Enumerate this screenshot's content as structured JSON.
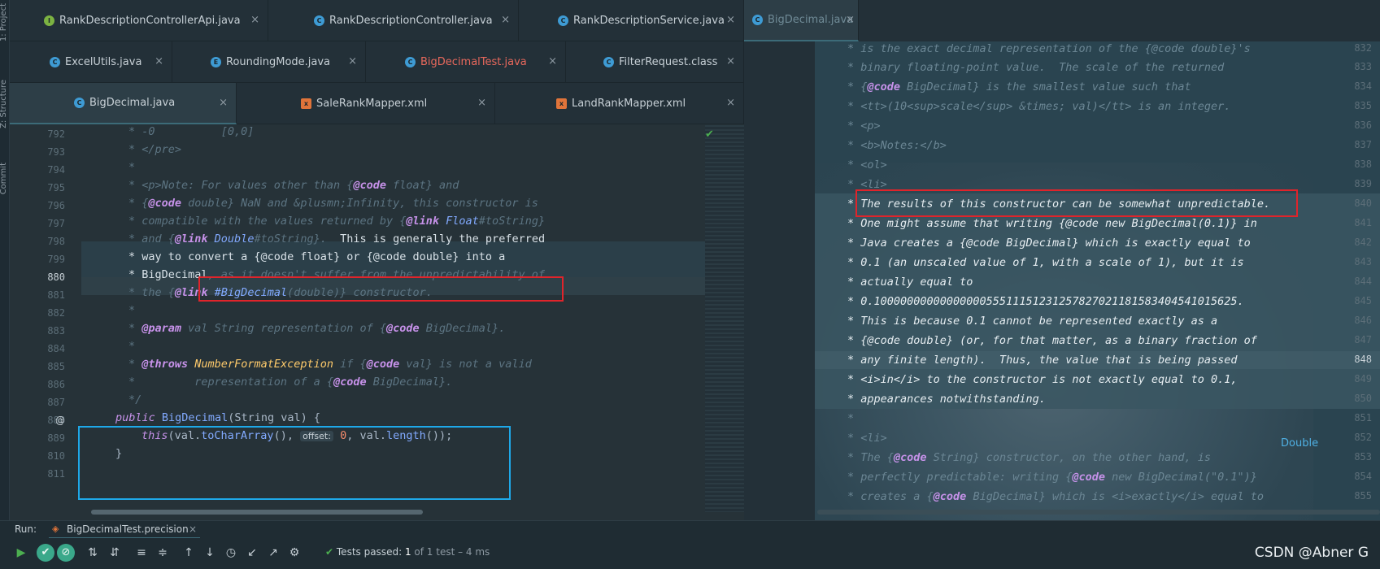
{
  "tool_strip": {
    "project_label": "1: Project",
    "structure_label": "Z: Structure",
    "commit_label": "Commit"
  },
  "left_tabs": {
    "row1": [
      {
        "label": "RankDescriptionControllerApi.java",
        "icon": "interface-icon",
        "icon_color": "#7cb342"
      },
      {
        "label": "RankDescriptionController.java",
        "icon": "class-icon",
        "icon_color": "#3e9bd4"
      },
      {
        "label": "RankDescriptionService.java",
        "icon": "class-icon",
        "icon_color": "#3e9bd4"
      }
    ],
    "row2": [
      {
        "label": "ExcelUtils.java",
        "icon": "class-icon",
        "icon_color": "#3e9bd4"
      },
      {
        "label": "RoundingMode.java",
        "icon": "enum-icon",
        "icon_color": "#3e9bd4"
      },
      {
        "label": "BigDecimalTest.java",
        "icon": "test-class-icon",
        "icon_color": "#3e9bd4",
        "highlight": true
      },
      {
        "label": "FilterRequest.class",
        "icon": "class-file-icon",
        "icon_color": "#3e9bd4"
      }
    ],
    "row3": [
      {
        "label": "BigDecimal.java",
        "icon": "class-icon",
        "icon_color": "#3e9bd4",
        "active": true
      },
      {
        "label": "SaleRankMapper.xml",
        "icon": "xml-icon",
        "icon_color": "#e0743a"
      },
      {
        "label": "LandRankMapper.xml",
        "icon": "xml-icon",
        "icon_color": "#e0743a"
      }
    ],
    "close_glyph": "×"
  },
  "right_tab": {
    "label": "BigDecimal.java",
    "close_glyph": "×"
  },
  "left_editor": {
    "lines": [
      {
        "n": "792",
        "text": "* -0          [0,0]"
      },
      {
        "n": "793",
        "text": "* </pre>"
      },
      {
        "n": "794",
        "text": "*"
      },
      {
        "n": "795",
        "a": "* <p>Note: For values other than {",
        "tag": "@code",
        "b": " float} and"
      },
      {
        "n": "796",
        "a": "* {",
        "tag": "@code",
        "b": " double} NaN and &plusmn;Infinity, this constructor is"
      },
      {
        "n": "797",
        "a": "* compatible with the values returned by {",
        "tag": "@link",
        "ref": " Float",
        "b": "#toString}"
      },
      {
        "n": "798",
        "a": "* and {",
        "tag": "@link",
        "ref": " Double",
        "b": "#toString}.  ",
        "sel": "This is generally the preferred"
      },
      {
        "n": "799",
        "sel": "* way to convert a {@code float} or {@code double} into a"
      },
      {
        "n": "880",
        "sel": "* BigDecimal",
        "b": ", as it doesn't suffer from the unpredictability of"
      },
      {
        "n": "881",
        "a": "* the {",
        "tag": "@link",
        "ref": " #BigDecimal",
        "b": "(double)} constructor."
      },
      {
        "n": "882",
        "text": "*"
      },
      {
        "n": "883",
        "a": "* ",
        "tag": "@param",
        "b": " val String representation of {",
        "tag2": "@code",
        "c": " BigDecimal}."
      },
      {
        "n": "884",
        "text": "*"
      },
      {
        "n": "885",
        "a": "* ",
        "tag": "@throws",
        "typ": " NumberFormatException",
        "b": " if {",
        "tag2": "@code",
        "c": " val} is not a valid"
      },
      {
        "n": "886",
        "a": "*         representation of a {",
        "tag": "@code",
        "b": " BigDecimal}."
      },
      {
        "n": "887",
        "text": "*/"
      },
      {
        "n": "888",
        "text": ""
      },
      {
        "n": "889",
        "text": ""
      },
      {
        "n": "810",
        "text": ""
      },
      {
        "n": "811",
        "text": ""
      }
    ],
    "constructor": {
      "public_kw": "public",
      "name": "BigDecimal",
      "sig_rest": "(String val) {",
      "this_kw": "this",
      "call_a": "(val.",
      "call_fn": "toCharArray",
      "call_b": "(),",
      "hint": "offset:",
      "call_num": "0",
      "call_c": ", val.",
      "call_fn2": "length",
      "call_d": "());",
      "close": "}"
    },
    "gutter_marker": "@"
  },
  "right_editor": {
    "lines": [
      {
        "n": "832",
        "text": "* is the exact decimal representation of the {@code double}'s"
      },
      {
        "n": "833",
        "text": "* binary floating-point value.  The scale of the returned"
      },
      {
        "n": "834",
        "a": "* {",
        "tag": "@code",
        "b": " BigDecimal} is the smallest value such that"
      },
      {
        "n": "835",
        "text": "* <tt>(10<sup>scale</sup> &times; val)</tt> is an integer."
      },
      {
        "n": "836",
        "text": "* <p>"
      },
      {
        "n": "837",
        "text": "* <b>Notes:</b>"
      },
      {
        "n": "838",
        "text": "* <ol>"
      },
      {
        "n": "839",
        "text": "* <li>"
      },
      {
        "n": "840",
        "sel": "* The results of this constructor can be somewhat unpredictable."
      },
      {
        "n": "841",
        "sel": "* One might assume that writing {@code new BigDecimal(0.1)} in"
      },
      {
        "n": "842",
        "sel": "* Java creates a {@code BigDecimal} which is exactly equal to"
      },
      {
        "n": "843",
        "sel": "* 0.1 (an unscaled value of 1, with a scale of 1), but it is"
      },
      {
        "n": "844",
        "sel": "* actually equal to"
      },
      {
        "n": "845",
        "sel": "* 0.1000000000000000055511151231257827021181583404541015625."
      },
      {
        "n": "846",
        "sel": "* This is because 0.1 cannot be represented exactly as a"
      },
      {
        "n": "847",
        "sel": "* {@code double} (or, for that matter, as a binary fraction of"
      },
      {
        "n": "848",
        "sel": "* any finite length).  Thus, the value that is being passed"
      },
      {
        "n": "849",
        "sel": "* <i>in</i> to the constructor is not exactly equal to 0.1,"
      },
      {
        "n": "850",
        "sel": "* appearances notwithstanding."
      },
      {
        "n": "851",
        "text": "*"
      },
      {
        "n": "852",
        "text": "* <li>"
      },
      {
        "n": "853",
        "a": "* The {",
        "tag": "@code",
        "b": " String} constructor, on the other hand, is"
      },
      {
        "n": "854",
        "a": "* perfectly predictable: writing {",
        "tag": "@code",
        "b": " new BigDecimal(\"0.1\")}"
      },
      {
        "n": "855",
        "a": "* creates a {",
        "tag": "@code",
        "b": " BigDecimal} which is <i>exactly</i> equal to"
      }
    ],
    "popup_link": "Double"
  },
  "run_panel": {
    "run_label": "Run:",
    "config_name": "BigDecimalTest.precision",
    "close_glyph": "×",
    "status_prefix": "Tests passed:",
    "status_count": "1",
    "status_suffix": "of 1 test – 4 ms"
  },
  "watermark": "CSDN @Abner G"
}
